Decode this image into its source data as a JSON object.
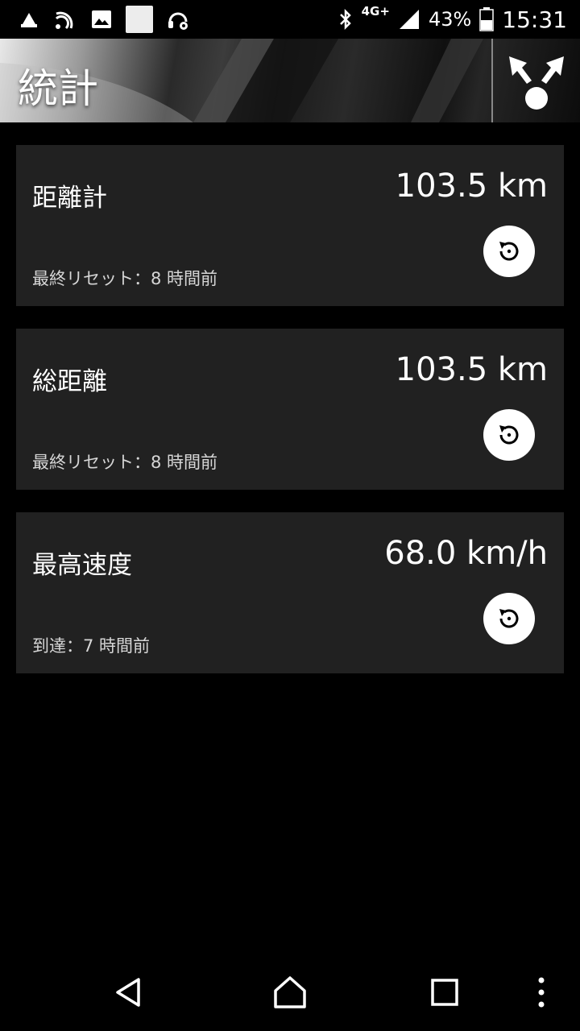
{
  "status_bar": {
    "network_label": "4G+",
    "battery_percent": "43%",
    "time": "15:31",
    "icons": [
      "notification-app-icon",
      "nfc-on-icon",
      "image-icon",
      "blank-notification-icon",
      "headset-settings-icon",
      "bluetooth-icon",
      "signal-icon",
      "battery-icon"
    ]
  },
  "header": {
    "title": "統計",
    "action_icon": "share-icon"
  },
  "cards": [
    {
      "title": "距離計",
      "value": "103.5 km",
      "sub": "最終リセット：8 時間前"
    },
    {
      "title": "総距離",
      "value": "103.5 km",
      "sub": "最終リセット：8 時間前"
    },
    {
      "title": "最高速度",
      "value": "68.0 km/h",
      "sub": "到達：7 時間前"
    }
  ],
  "nav_bar": {
    "icons": [
      "back-icon",
      "home-icon",
      "recents-icon",
      "overflow-menu-icon"
    ]
  },
  "colors": {
    "background": "#000000",
    "card": "#212121",
    "text": "#ffffff",
    "subtext": "#d6d6d6"
  }
}
